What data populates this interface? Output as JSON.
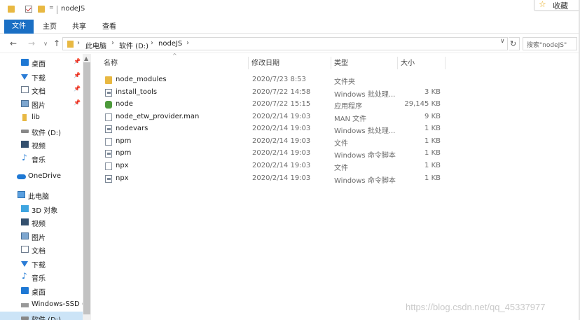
{
  "window": {
    "title": "nodeJS",
    "favorite_label": "收藏",
    "quick_access_dropdown": "="
  },
  "ribbon": {
    "tabs": [
      "文件",
      "主页",
      "共享",
      "查看"
    ]
  },
  "address_bar": {
    "breadcrumbs": [
      "此电脑",
      "软件 (D:)",
      "nodeJS"
    ],
    "search_placeholder": "搜索\"nodeJS\""
  },
  "nav_pane": {
    "items": [
      {
        "label": "桌面",
        "icon": "desktop-icon",
        "pinned": true
      },
      {
        "label": "下载",
        "icon": "download-icon",
        "pinned": true
      },
      {
        "label": "文档",
        "icon": "documents-icon",
        "pinned": true
      },
      {
        "label": "图片",
        "icon": "pictures-icon",
        "pinned": true
      },
      {
        "label": "lib",
        "icon": "folder-icon",
        "pinned": false
      },
      {
        "label": "软件 (D:)",
        "icon": "drive-icon",
        "pinned": false
      },
      {
        "label": "视频",
        "icon": "videos-icon",
        "pinned": false
      },
      {
        "label": "音乐",
        "icon": "music-icon",
        "pinned": false
      },
      {
        "label": "OneDrive",
        "icon": "onedrive-icon",
        "pinned": false
      },
      {
        "label": "此电脑",
        "icon": "this-pc-icon",
        "pinned": false
      },
      {
        "label": "3D 对象",
        "icon": "3d-objects-icon",
        "pinned": false
      },
      {
        "label": "视频",
        "icon": "videos-icon",
        "pinned": false
      },
      {
        "label": "图片",
        "icon": "pictures-icon",
        "pinned": false
      },
      {
        "label": "文档",
        "icon": "documents-icon",
        "pinned": false
      },
      {
        "label": "下载",
        "icon": "download-icon",
        "pinned": false
      },
      {
        "label": "音乐",
        "icon": "music-icon",
        "pinned": false
      },
      {
        "label": "桌面",
        "icon": "desktop-icon",
        "pinned": false
      },
      {
        "label": "Windows-SSD (",
        "icon": "ssd-drive-icon",
        "pinned": false
      },
      {
        "label": "软件 (D:)",
        "icon": "drive-icon",
        "pinned": false
      }
    ]
  },
  "file_list": {
    "columns": [
      "名称",
      "修改日期",
      "类型",
      "大小"
    ],
    "rows": [
      {
        "name": "node_modules",
        "date": "2020/7/23 8:53",
        "type": "文件夹",
        "size": "",
        "icon": "folder-icon"
      },
      {
        "name": "install_tools",
        "date": "2020/7/22 14:58",
        "type": "Windows 批处理...",
        "size": "3 KB",
        "icon": "batch-file-icon"
      },
      {
        "name": "node",
        "date": "2020/7/22 15:15",
        "type": "应用程序",
        "size": "29,145 KB",
        "icon": "node-app-icon"
      },
      {
        "name": "node_etw_provider.man",
        "date": "2020/2/14 19:03",
        "type": "MAN 文件",
        "size": "9 KB",
        "icon": "file-icon"
      },
      {
        "name": "nodevars",
        "date": "2020/2/14 19:03",
        "type": "Windows 批处理...",
        "size": "1 KB",
        "icon": "batch-file-icon"
      },
      {
        "name": "npm",
        "date": "2020/2/14 19:03",
        "type": "文件",
        "size": "1 KB",
        "icon": "file-icon"
      },
      {
        "name": "npm",
        "date": "2020/2/14 19:03",
        "type": "Windows 命令脚本",
        "size": "1 KB",
        "icon": "batch-file-icon"
      },
      {
        "name": "npx",
        "date": "2020/2/14 19:03",
        "type": "文件",
        "size": "1 KB",
        "icon": "file-icon"
      },
      {
        "name": "npx",
        "date": "2020/2/14 19:03",
        "type": "Windows 命令脚本",
        "size": "1 KB",
        "icon": "batch-file-icon"
      }
    ]
  },
  "watermark": "https://blog.csdn.net/qq_45337977"
}
